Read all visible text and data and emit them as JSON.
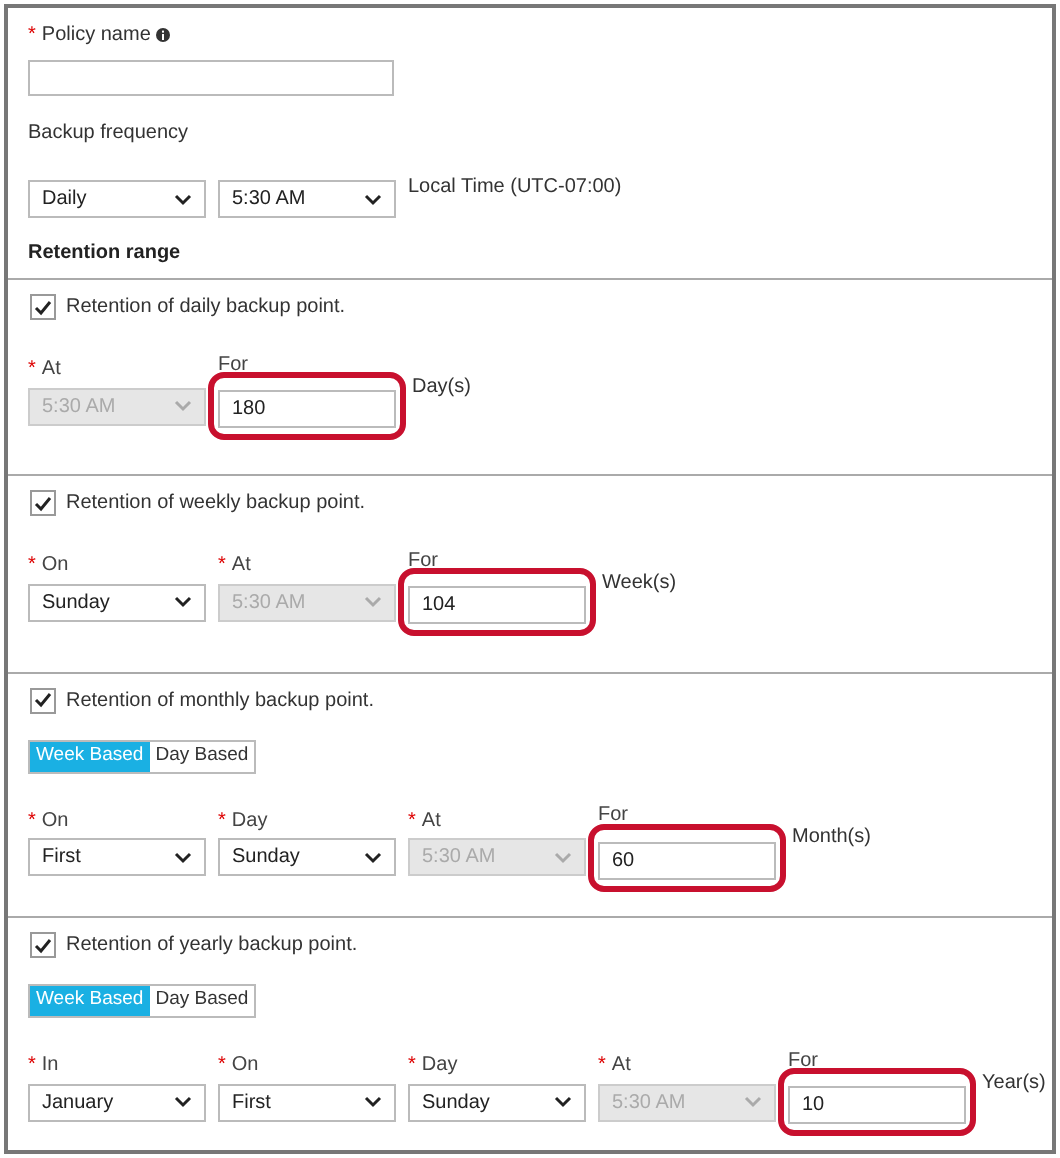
{
  "policy_name": {
    "label": "Policy name",
    "required_mark": "*"
  },
  "backup_frequency": {
    "label": "Backup frequency",
    "fields": [
      {
        "kind": "select",
        "value": "Daily",
        "disabled": false,
        "highlighted": false
      },
      {
        "kind": "select",
        "value": "5:30 AM",
        "disabled": false,
        "highlighted": false
      }
    ],
    "note": "Local Time (UTC-07:00)"
  },
  "retention_range": {
    "title": "Retention range",
    "sections": [
      {
        "label": "Retention of daily backup point.",
        "checked": true,
        "fields": [
          {
            "label": "At",
            "required_mark": "*",
            "kind": "select",
            "value": "5:30 AM",
            "disabled": true,
            "highlighted": false
          },
          {
            "label": "For",
            "kind": "text",
            "value": "180",
            "disabled": false,
            "highlighted": true
          }
        ],
        "unit": "Day(s)"
      },
      {
        "label": "Retention of weekly backup point.",
        "checked": true,
        "fields": [
          {
            "label": "On",
            "required_mark": "*",
            "kind": "select",
            "value": "Sunday",
            "disabled": false,
            "highlighted": false
          },
          {
            "label": "At",
            "required_mark": "*",
            "kind": "select",
            "value": "5:30 AM",
            "disabled": true,
            "highlighted": false
          },
          {
            "label": "For",
            "kind": "text",
            "value": "104",
            "disabled": false,
            "highlighted": true
          }
        ],
        "unit": "Week(s)"
      },
      {
        "label": "Retention of monthly backup point.",
        "checked": true,
        "toggle": [
          {
            "label": "Week Based",
            "selected": true
          },
          {
            "label": "Day Based",
            "selected": false
          }
        ],
        "fields": [
          {
            "label": "On",
            "required_mark": "*",
            "kind": "select",
            "value": "First",
            "disabled": false,
            "highlighted": false
          },
          {
            "label": "Day",
            "required_mark": "*",
            "kind": "select",
            "value": "Sunday",
            "disabled": false,
            "highlighted": false
          },
          {
            "label": "At",
            "required_mark": "*",
            "kind": "select",
            "value": "5:30 AM",
            "disabled": true,
            "highlighted": false
          },
          {
            "label": "For",
            "kind": "text",
            "value": "60",
            "disabled": false,
            "highlighted": true
          }
        ],
        "unit": "Month(s)"
      },
      {
        "label": "Retention of yearly backup point.",
        "checked": true,
        "toggle": [
          {
            "label": "Week Based",
            "selected": true
          },
          {
            "label": "Day Based",
            "selected": false
          }
        ],
        "fields": [
          {
            "label": "In",
            "required_mark": "*",
            "kind": "select",
            "value": "January",
            "disabled": false,
            "highlighted": false
          },
          {
            "label": "On",
            "required_mark": "*",
            "kind": "select",
            "value": "First",
            "disabled": false,
            "highlighted": false
          },
          {
            "label": "Day",
            "required_mark": "*",
            "kind": "select",
            "value": "Sunday",
            "disabled": false,
            "highlighted": false
          },
          {
            "label": "At",
            "required_mark": "*",
            "kind": "select",
            "value": "5:30 AM",
            "disabled": true,
            "highlighted": false
          },
          {
            "label": "For",
            "kind": "text",
            "value": "10",
            "disabled": false,
            "highlighted": true
          }
        ],
        "unit": "Year(s)"
      }
    ]
  }
}
